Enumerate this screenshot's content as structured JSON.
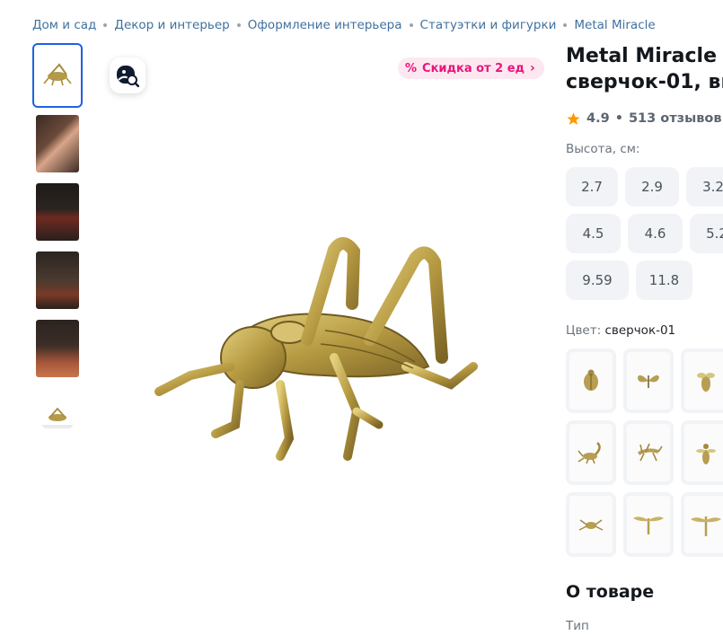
{
  "breadcrumb": [
    "Дом и сад",
    "Декор и интерьер",
    "Оформление интерьера",
    "Статуэтки и фигурки",
    "Metal Miracle"
  ],
  "promo": {
    "label": "Скидка от 2 ед"
  },
  "product": {
    "title": "Metal Miracle С\nсверчок-01, вы",
    "rating": "4.9",
    "reviews": "513 отзывов",
    "rating_separator": "•"
  },
  "sizes": {
    "label": "Высота, см:",
    "options": [
      "2.7",
      "2.9",
      "3.2",
      "4.5",
      "4.6",
      "5.2",
      "9.59",
      "11.8"
    ]
  },
  "color": {
    "label": "Цвет:",
    "selected": "сверчок-01",
    "tiles": [
      "beetle-icon",
      "butterfly-icon",
      "bee-icon",
      "scorpion-icon",
      "mantis-icon",
      "wasp-icon",
      "spider-icon",
      "dragonfly-icon",
      "dragonfly-icon"
    ]
  },
  "about": {
    "title": "О товаре",
    "type_label": "Тип"
  },
  "colors": {
    "accent": "#1e63e0",
    "promo": "#e9157b",
    "link": "#40709f",
    "star": "#ff9800"
  }
}
